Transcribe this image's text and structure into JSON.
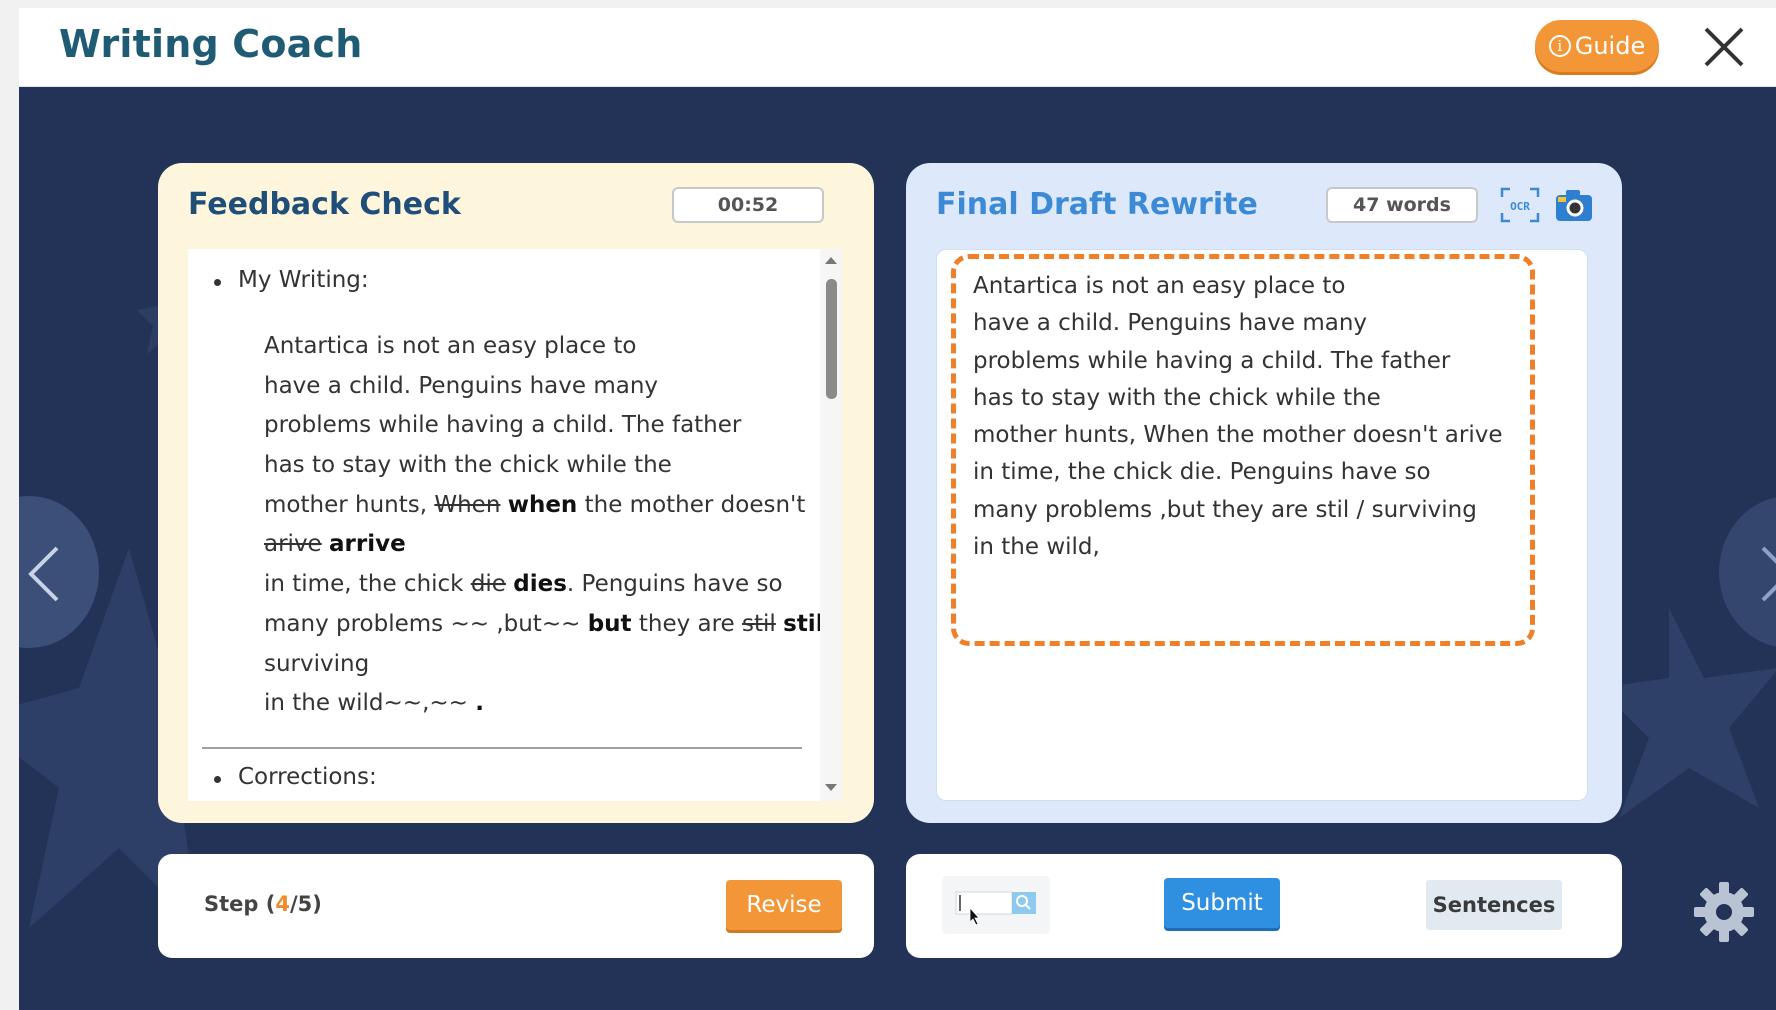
{
  "app": {
    "title": "Writing Coach",
    "guide_label": "Guide",
    "guide_icon": "info-icon",
    "close_icon": "close-icon",
    "colors": {
      "background": "#233357",
      "accent_orange": "#f39637",
      "accent_blue": "#2f8fe0",
      "title_teal": "#1f5c74"
    }
  },
  "feedback": {
    "title": "Feedback Check",
    "timer": "00:52",
    "writing_heading": "My Writing:",
    "corrections_heading": "Corrections:",
    "lines": [
      [
        "Antartica is not an easy place to"
      ],
      [
        "have a child. Penguins have many"
      ],
      [
        "problems while having a child. The father"
      ],
      [
        "has to stay with the chick while the"
      ],
      [
        "mother hunts, ",
        "When",
        " ",
        "when",
        " the mother doesn't"
      ],
      [
        "arive",
        " ",
        "arrive"
      ],
      [
        "in time, the chick ",
        "die",
        " ",
        "dies",
        ". Penguins have so"
      ],
      [
        "many problems ~~ ,but~~ ",
        "but",
        " they are ",
        "stil",
        " ",
        "still",
        " /"
      ],
      [
        "surviving"
      ],
      [
        "in the wild~~,~~ ",
        "."
      ]
    ]
  },
  "draft": {
    "title": "Final Draft Rewrite",
    "word_count": "47 words",
    "ocr_label": "OCR",
    "camera_icon": "camera-icon",
    "lines": [
      "Antartica is not an easy place to",
      "have a child. Penguins have many",
      "problems while having a child. The father",
      "has to stay with the chick while the",
      "mother hunts, When the mother doesn't arive",
      "in time, the chick die. Penguins have so",
      "many problems ,but they are stil / surviving",
      "in the wild,"
    ]
  },
  "footer": {
    "step_prefix": "Step (",
    "step_current": "4",
    "step_suffix": "/5)",
    "revise_label": "Revise",
    "submit_label": "Submit",
    "sentences_label": "Sentences",
    "search_icon": "search-icon",
    "settings_icon": "gear-icon"
  }
}
